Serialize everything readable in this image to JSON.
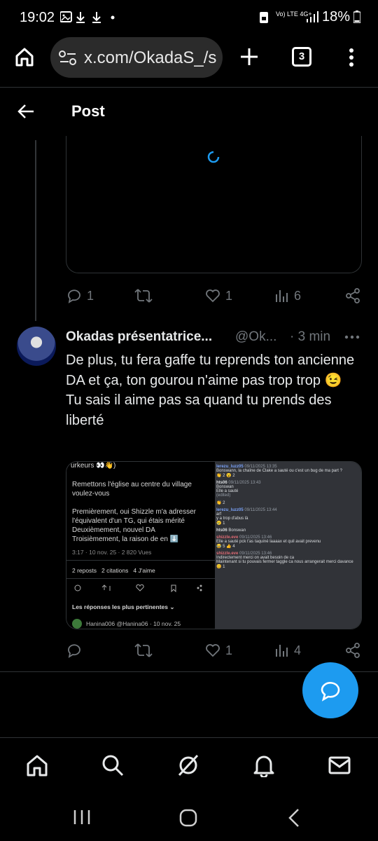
{
  "status_bar": {
    "time": "19:02",
    "network": "Vo) LTE 4G+",
    "battery": "18%"
  },
  "browser": {
    "url": "x.com/OkadaS_/s",
    "tab_count": "3"
  },
  "header": {
    "title": "Post"
  },
  "first_post_actions": {
    "replies": "1",
    "reposts": "",
    "likes": "1",
    "views": "6"
  },
  "reply": {
    "display_name": "Okadas présentatrice...",
    "handle": "@Ok...",
    "time": "· 3 min",
    "text": "De plus, tu fera gaffe tu reprends ton ancienne DA et ça, ton gourou n'aime pas trop trop 😉\nTu sais il aime pas sa quand tu prends des liberté",
    "actions": {
      "replies": "",
      "reposts": "",
      "likes": "1",
      "views": "4"
    }
  },
  "media_left": {
    "top_line": "urkeurs 👀👋)",
    "line1": "Remettons l'église au centre du village voulez-vous",
    "line2": "Premièrement, oui Shizzle m'a adresser l'équivalent d'un TG, qui étais mérité\nDeuxièmement, nouvel DA\nTroisièmement, la raison de en ⬇️",
    "meta": "3:17 · 10 nov. 25 · 2 820 Vues",
    "stats": "2 reposts   2 citations   4 J'aime",
    "best_replies": "Les réponses les plus pertinentes ⌄",
    "reply_author": "Hanina006 @Hanina06 · 10 nov. 25"
  },
  "media_right": {
    "messages": [
      {
        "author": "lerezu_luzz05",
        "time": "09/11/2025 13:35",
        "text": "Bonswann, la chaîne de Clake a sauté ou c'est un bug de ma part ?",
        "reacts": "👏 2  😮 2"
      },
      {
        "author": "hts06",
        "time": "09/11/2025 13:43",
        "text": "Bonswan\nElle a sauté",
        "reacts": "(edited)"
      },
      {
        "author": "",
        "time": "",
        "text": "",
        "reacts": "👏 2"
      },
      {
        "author": "lerezu_luzz05",
        "time": "09/11/2025 13:44",
        "text": "arf\ny a trop d'abus là",
        "reacts": "😢 1"
      },
      {
        "author": "hts06",
        "time": "",
        "text": "Bonswan",
        "reacts": ""
      },
      {
        "author": "shizzle.eve",
        "time": "09/11/2025 13:46",
        "text": "Elle a sauté pck t'as taquiné laaaax et quil avait prevenu",
        "reacts": "😂 5  👍 4"
      },
      {
        "author": "shizzle.eve",
        "time": "09/11/2025 13:46",
        "text": "Indirectement merci on avait besoin de ca\nMaintenant si tu pouvais fermer taggle ca nous arrangerait merci davance",
        "reacts": "😊 1"
      }
    ]
  },
  "icons": {
    "home": "home-icon",
    "search": "search-icon",
    "grok": "grok-icon",
    "notifications": "bell-icon",
    "messages": "mail-icon"
  },
  "colors": {
    "accent": "#1d9bf0",
    "background": "#000000",
    "muted": "#71767b"
  }
}
